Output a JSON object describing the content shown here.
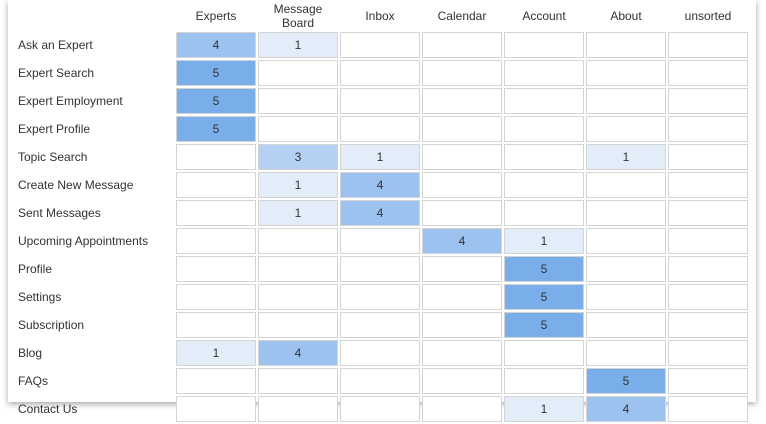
{
  "columns": [
    "Experts",
    "Message Board",
    "Inbox",
    "Calendar",
    "Account",
    "About",
    "unsorted"
  ],
  "rows": [
    {
      "label": "Ask an Expert",
      "cells": [
        "4",
        "1",
        "",
        "",
        "",
        "",
        ""
      ]
    },
    {
      "label": "Expert Search",
      "cells": [
        "5",
        "",
        "",
        "",
        "",
        "",
        ""
      ]
    },
    {
      "label": "Expert Employment",
      "cells": [
        "5",
        "",
        "",
        "",
        "",
        "",
        ""
      ]
    },
    {
      "label": "Expert Profile",
      "cells": [
        "5",
        "",
        "",
        "",
        "",
        "",
        ""
      ]
    },
    {
      "label": "Topic Search",
      "cells": [
        "",
        "3",
        "1",
        "",
        "",
        "1",
        ""
      ]
    },
    {
      "label": "Create New Message",
      "cells": [
        "",
        "1",
        "4",
        "",
        "",
        "",
        ""
      ]
    },
    {
      "label": "Sent Messages",
      "cells": [
        "",
        "1",
        "4",
        "",
        "",
        "",
        ""
      ]
    },
    {
      "label": "Upcoming Appointments",
      "cells": [
        "",
        "",
        "",
        "4",
        "1",
        "",
        ""
      ]
    },
    {
      "label": "Profile",
      "cells": [
        "",
        "",
        "",
        "",
        "5",
        "",
        ""
      ]
    },
    {
      "label": "Settings",
      "cells": [
        "",
        "",
        "",
        "",
        "5",
        "",
        ""
      ]
    },
    {
      "label": "Subscription",
      "cells": [
        "",
        "",
        "",
        "",
        "5",
        "",
        ""
      ]
    },
    {
      "label": "Blog",
      "cells": [
        "1",
        "4",
        "",
        "",
        "",
        "",
        ""
      ]
    },
    {
      "label": "FAQs",
      "cells": [
        "",
        "",
        "",
        "",
        "",
        "5",
        ""
      ]
    },
    {
      "label": "Contact Us",
      "cells": [
        "",
        "",
        "",
        "",
        "1",
        "4",
        ""
      ]
    }
  ],
  "heat_colors": {
    "1": "#e3edfa",
    "3": "#b4d1f3",
    "4": "#9cc2ef",
    "5": "#7aaeea",
    "empty": "#ffffff"
  }
}
